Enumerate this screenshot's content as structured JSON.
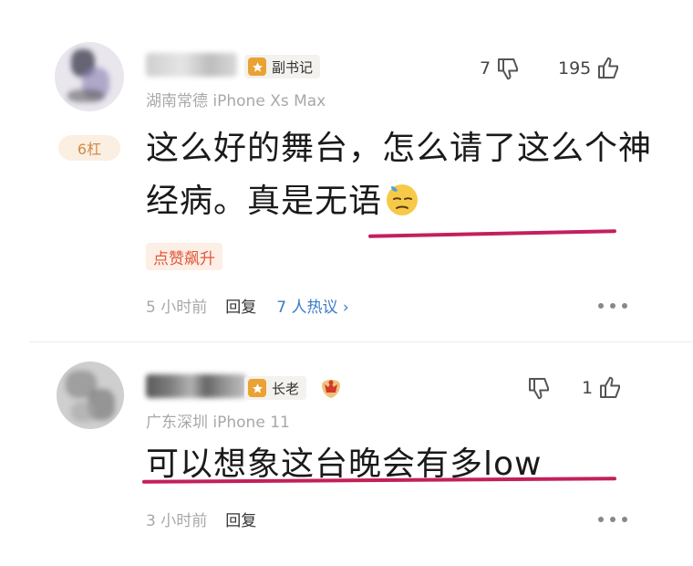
{
  "comments": [
    {
      "badge": "副书记",
      "device": "湖南常德  iPhone Xs Max",
      "downvotes": "7",
      "upvotes": "195",
      "level": "6杠",
      "text": "这么好的舞台，怎么请了这么个神经病。真是无语",
      "emoji": "downcast-sweat-emoji",
      "hot_tag": "点赞飙升",
      "time": "5 小时前",
      "reply": "回复",
      "discussion": "7 人热议 ›"
    },
    {
      "badge": "长老",
      "device": "广东深圳  iPhone 11",
      "downvotes": "",
      "upvotes": "1",
      "text": "可以想象这台晚会有多low",
      "time": "3 小时前",
      "reply": "回复"
    }
  ],
  "colors": {
    "highlight_underline": "#c2205c",
    "discussion_link": "#3b7bc8",
    "badge_icon": "#e9a233",
    "hot_tag": "#e0583a"
  }
}
